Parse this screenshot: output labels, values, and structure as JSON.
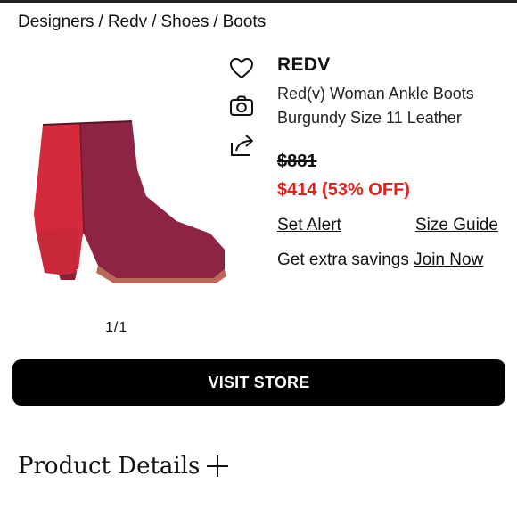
{
  "breadcrumb": {
    "items": [
      "Designers",
      "Redv",
      "Shoes",
      "Boots"
    ],
    "separator": "/"
  },
  "icons": {
    "favorite": "heart-icon",
    "photo": "camera-icon",
    "share": "share-icon"
  },
  "product": {
    "brand": "REDV",
    "title": "Red(v) Woman Ankle Boots Burgundy Size 11 Leather",
    "original_price": "$881",
    "sale_price": "$414 (53% OFF)",
    "image_counter": "1/1"
  },
  "links": {
    "set_alert": "Set Alert",
    "size_guide": "Size Guide"
  },
  "savings": {
    "text": "Get extra savings",
    "link": "Join Now"
  },
  "actions": {
    "visit_store": "VISIT STORE"
  },
  "sections": {
    "product_details": "Product Details"
  },
  "colors": {
    "sale_red": "#e3211b",
    "boot_red": "#d42a3c",
    "boot_burgundy": "#8e2443",
    "button_bg": "#000000"
  }
}
